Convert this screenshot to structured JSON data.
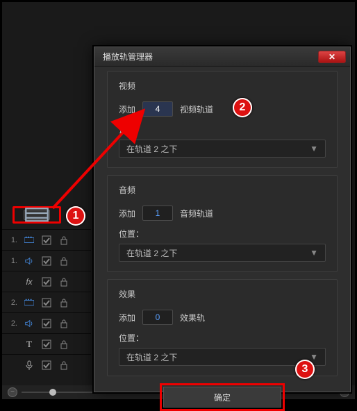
{
  "dialog": {
    "title": "播放轨管理器",
    "video": {
      "section_title": "视频",
      "add_label": "添加",
      "count": "4",
      "track_label": "视频轨道",
      "position_label": "置：",
      "position_value": "在轨道 2 之下"
    },
    "audio": {
      "section_title": "音频",
      "add_label": "添加",
      "count": "1",
      "track_label": "音频轨道",
      "position_label": "位置：",
      "position_value": "在轨道 2 之下"
    },
    "effect": {
      "section_title": "效果",
      "add_label": "添加",
      "count": "0",
      "track_label": "效果轨",
      "position_label": "位置：",
      "position_value": "在轨道 2 之下"
    },
    "ok_label": "确定"
  },
  "tracks": {
    "r1": "1.",
    "r2": "1.",
    "r3": "",
    "r4": "2.",
    "r5": "2.",
    "r6": "T",
    "r7": ""
  },
  "badges": {
    "b1": "1",
    "b2": "2",
    "b3": "3"
  }
}
